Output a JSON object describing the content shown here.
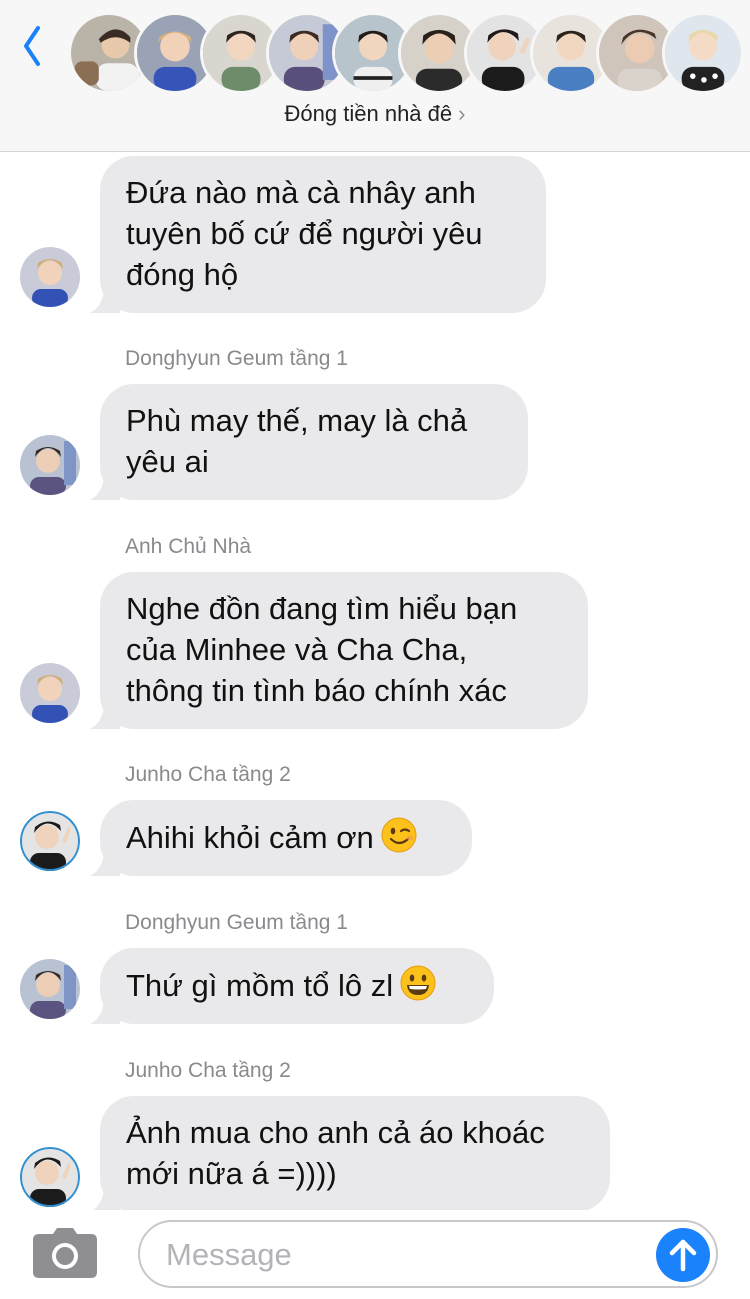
{
  "header": {
    "group_name": "Đóng tiền nhà đê",
    "chevron": "›",
    "back_icon": "chevron-left-icon",
    "avatar_count": 10
  },
  "colors": {
    "accent": "#1a82fb",
    "bubble": "#e9e9eb",
    "header_bg": "#f7f7f7"
  },
  "messages": [
    {
      "sender": "",
      "lines": [
        "Đứa nào mà cà nhây anh",
        "tuyên bố cứ để người yêu",
        "đóng hộ"
      ],
      "emoji": ""
    },
    {
      "sender": "Donghyun Geum tầng 1",
      "lines": [
        "Phù may thế, may là chả",
        "yêu ai"
      ],
      "emoji": ""
    },
    {
      "sender": "Anh Chủ Nhà",
      "lines": [
        "Nghe đồn đang tìm hiểu bạn",
        "của Minhee và Cha Cha,",
        "thông tin tình báo chính xác"
      ],
      "emoji": ""
    },
    {
      "sender": "Junho Cha tầng 2",
      "lines": [
        "Ahihi khỏi cảm ơn"
      ],
      "emoji": "winking-face-emoji"
    },
    {
      "sender": "Donghyun Geum tầng 1",
      "lines": [
        "Thứ gì mồm tổ lô zl"
      ],
      "emoji": "grinning-face-emoji"
    },
    {
      "sender": "Junho Cha tầng 2",
      "lines": [
        "Ảnh mua cho anh cả áo khoác",
        "mới nữa á =))))"
      ],
      "emoji": ""
    }
  ],
  "input": {
    "placeholder": "Message",
    "value": "",
    "camera_icon": "camera-icon",
    "send_icon": "arrow-up-icon"
  }
}
